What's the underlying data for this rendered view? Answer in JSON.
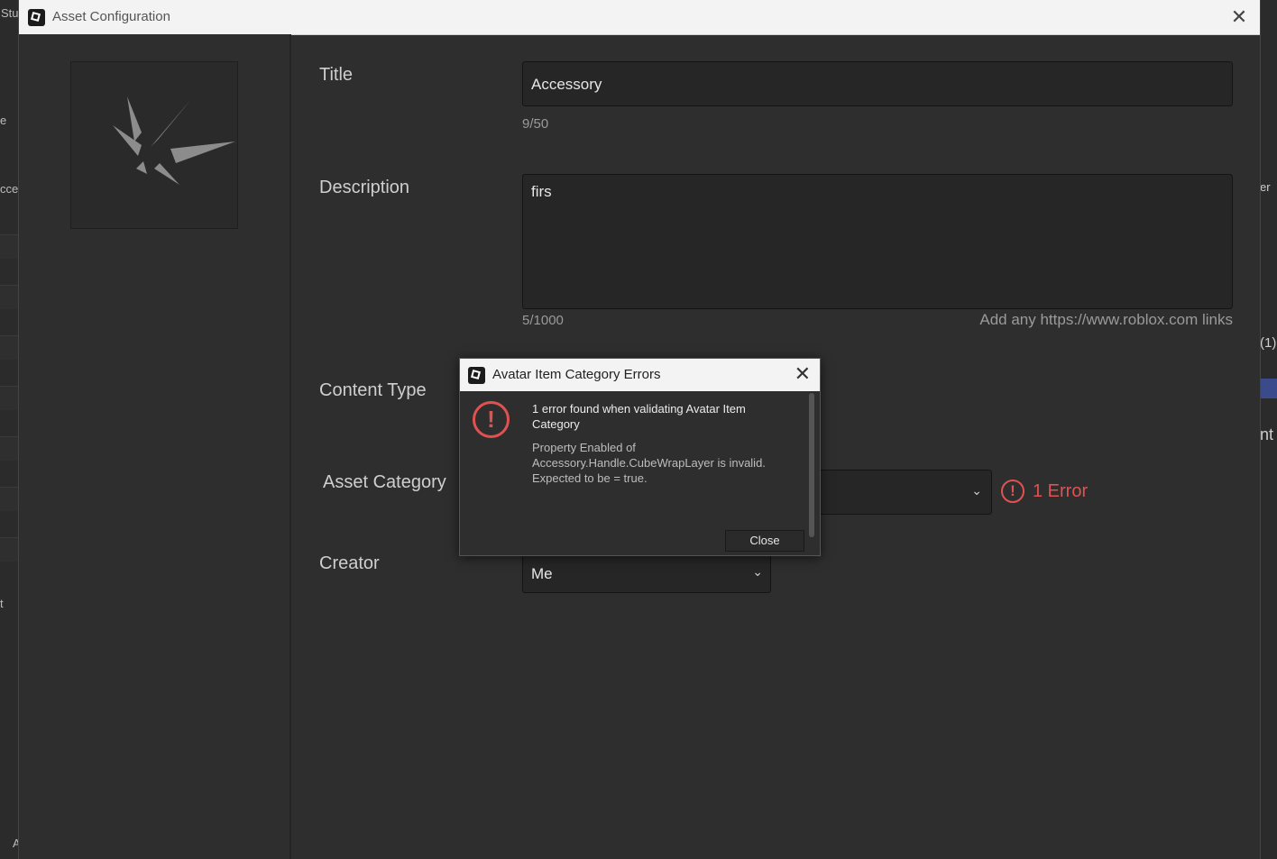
{
  "background": {
    "left_fragments": [
      "Stu",
      "e",
      "cces",
      "t",
      "A"
    ],
    "right_fragments": [
      "er",
      "(1)",
      "nt"
    ]
  },
  "window": {
    "title": "Asset Configuration",
    "close_glyph": "✕"
  },
  "form": {
    "title_label": "Title",
    "title_value": "Accessory",
    "title_counter": "9/50",
    "description_label": "Description",
    "description_value": "firs",
    "description_counter": "5/1000",
    "description_hint": "Add any https://www.roblox.com links",
    "content_type_label": "Content Type",
    "asset_category_label": "Asset Category",
    "asset_category_error": "1 Error",
    "creator_label": "Creator",
    "creator_value": "Me"
  },
  "dialog": {
    "title": "Avatar Item Category Errors",
    "heading": "1 error found when validating Avatar Item Category",
    "message": "Property Enabled of Accessory.Handle.CubeWrapLayer is invalid. Expected to be = true.",
    "close_label": "Close",
    "close_glyph": "✕"
  },
  "colors": {
    "error": "#e05252",
    "panel": "#2e2e2e",
    "field": "#262626"
  },
  "icons": {
    "error": "error-circle-icon",
    "chevron": "chevron-down-icon",
    "app": "roblox-studio-icon"
  }
}
